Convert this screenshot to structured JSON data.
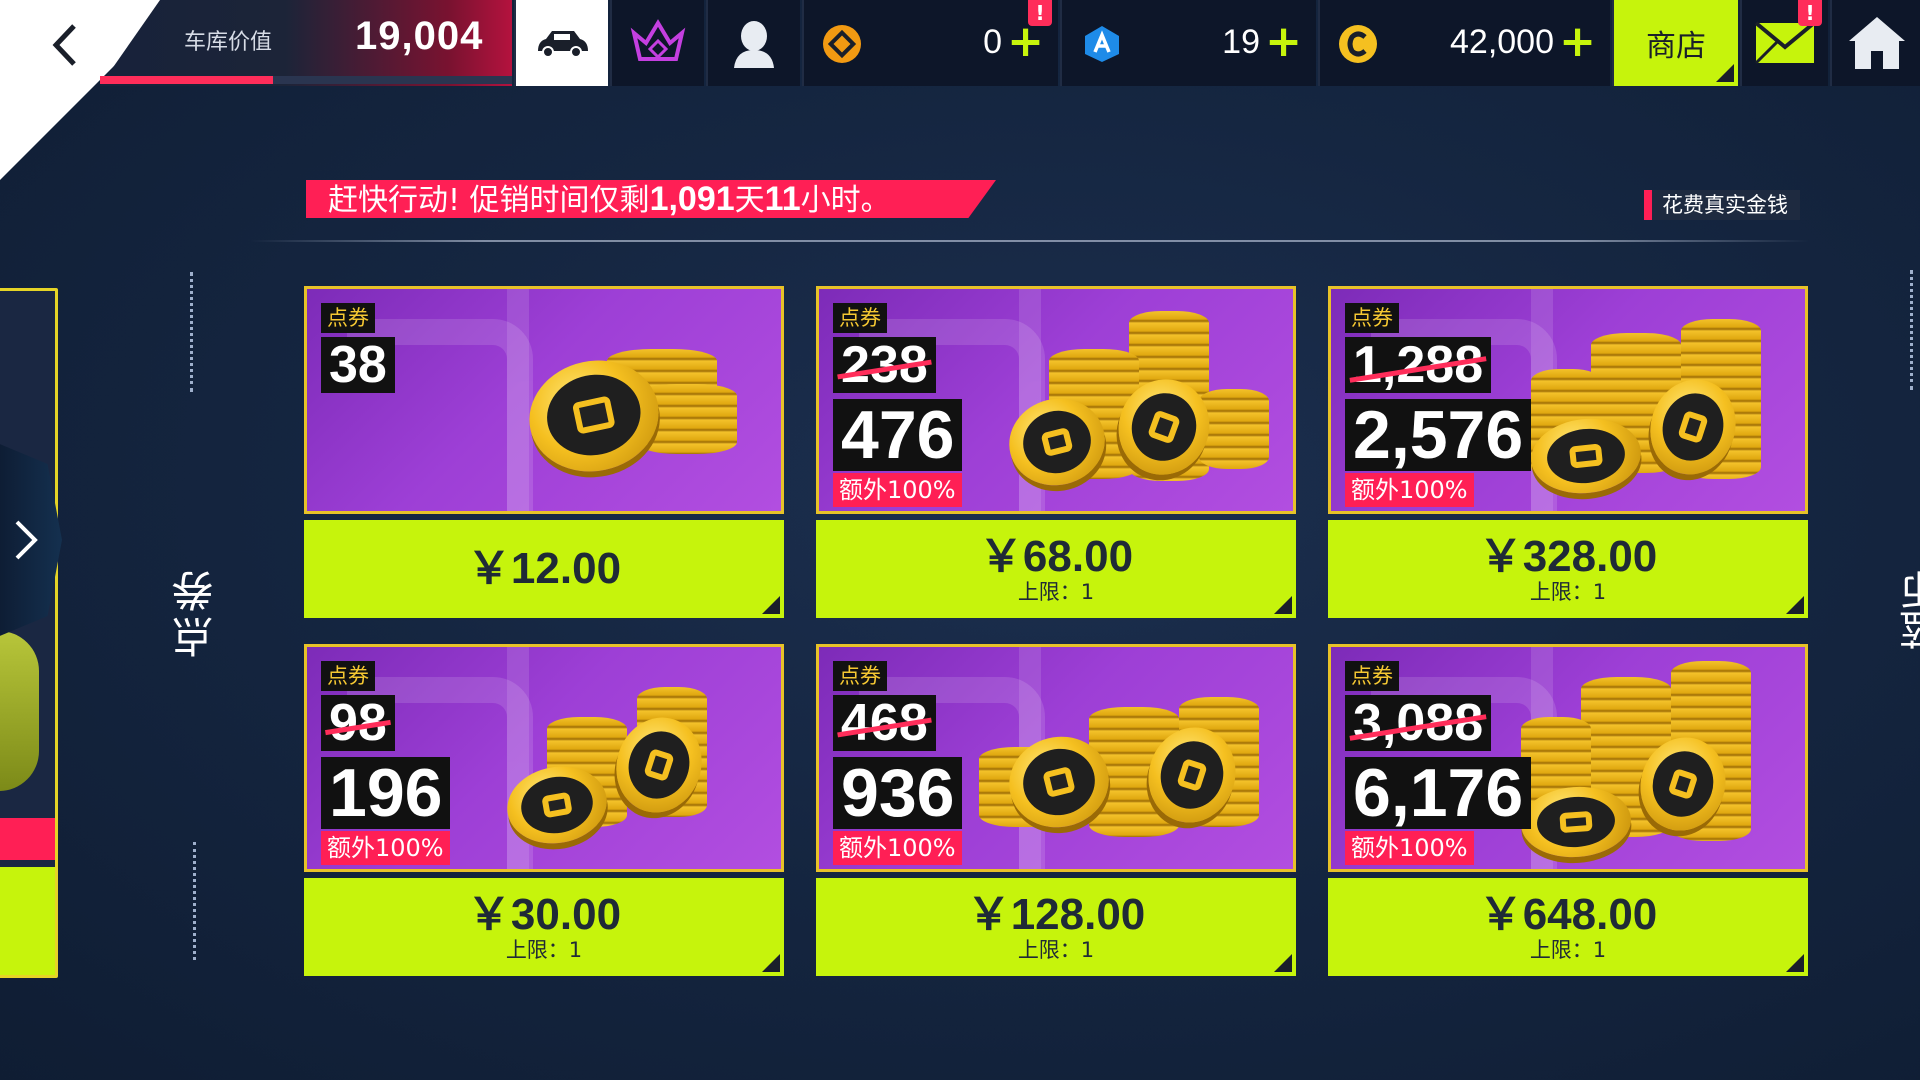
{
  "topbar": {
    "garage_label": "车库价值",
    "garage_value": "19,004",
    "garage_progress": 0.42,
    "tokens_value": "0",
    "blueprints_value": "19",
    "credits_value": "42,000",
    "plus": "+",
    "shop_label": "商店",
    "badge": "!"
  },
  "promo": {
    "prefix": "赶快行动!   促销时间仅剩",
    "days": "1,091",
    "days_unit": "天",
    "hours": "11",
    "hours_unit": "小时。"
  },
  "real_money_label": "花费真实金钱",
  "category_label": "点券",
  "right_category_label": "蓝币",
  "items": [
    {
      "tag": "点券",
      "old_amount": "",
      "amount": "38",
      "bonus": "",
      "price": "￥12.00",
      "limit": ""
    },
    {
      "tag": "点券",
      "old_amount": "238",
      "amount": "476",
      "bonus": "额外100%",
      "price": "￥68.00",
      "limit": "上限：1"
    },
    {
      "tag": "点券",
      "old_amount": "1,288",
      "amount": "2,576",
      "bonus": "额外100%",
      "price": "￥328.00",
      "limit": "上限：1"
    },
    {
      "tag": "点券",
      "old_amount": "98",
      "amount": "196",
      "bonus": "额外100%",
      "price": "￥30.00",
      "limit": "上限：1"
    },
    {
      "tag": "点券",
      "old_amount": "468",
      "amount": "936",
      "bonus": "额外100%",
      "price": "￥128.00",
      "limit": "上限：1"
    },
    {
      "tag": "点券",
      "old_amount": "3,088",
      "amount": "6,176",
      "bonus": "额外100%",
      "price": "￥648.00",
      "limit": "上限：1"
    }
  ],
  "colors": {
    "accent_green": "#c6f40c",
    "accent_pink": "#ff1f55",
    "card_purple": "#9d3fd6",
    "gold": "#f5c020"
  },
  "icons": [
    "back-icon",
    "car-icon",
    "crown-icon",
    "profile-icon",
    "token-icon",
    "blueprint-icon",
    "credit-icon",
    "mail-icon",
    "home-icon",
    "chevron-right-icon"
  ]
}
